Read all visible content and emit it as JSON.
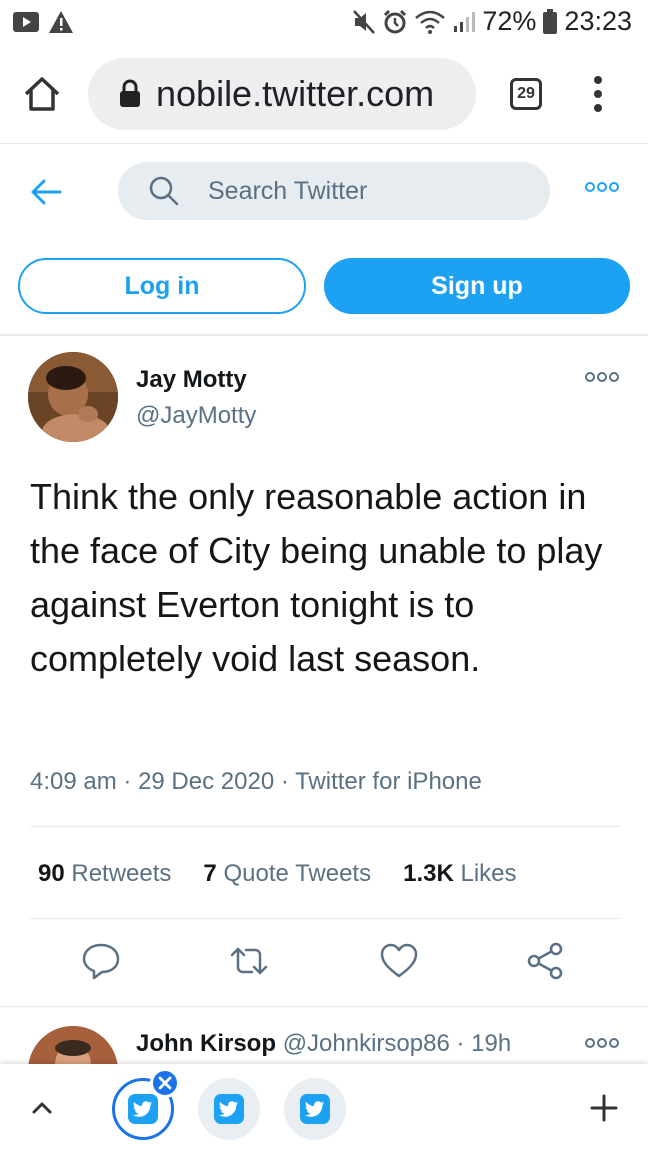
{
  "status_bar": {
    "battery": "72%",
    "time": "23:23"
  },
  "browser": {
    "url": "nobile.twitter.com",
    "tab_count": "29"
  },
  "twitter_header": {
    "search_placeholder": "Search Twitter"
  },
  "auth": {
    "login_label": "Log in",
    "signup_label": "Sign up"
  },
  "tweet": {
    "author_name": "Jay Motty",
    "author_handle": "@JayMotty",
    "text": "Think the only reasonable action in the face of City being unable to play against Everton tonight is to completely void last season.",
    "time": "4:09 am",
    "date": "29 Dec 2020",
    "source": "Twitter for iPhone",
    "retweets_count": "90",
    "retweets_label": "Retweets",
    "quote_count": "7",
    "quote_label": "Quote Tweets",
    "likes_count": "1.3K",
    "likes_label": "Likes"
  },
  "reply": {
    "name": "John Kirsop",
    "handle": "@Johnkirsop86",
    "age": "19h"
  },
  "colors": {
    "twitter_blue": "#1da1f2",
    "chrome_blue": "#1a73e8",
    "secondary_text": "#5b7083"
  }
}
